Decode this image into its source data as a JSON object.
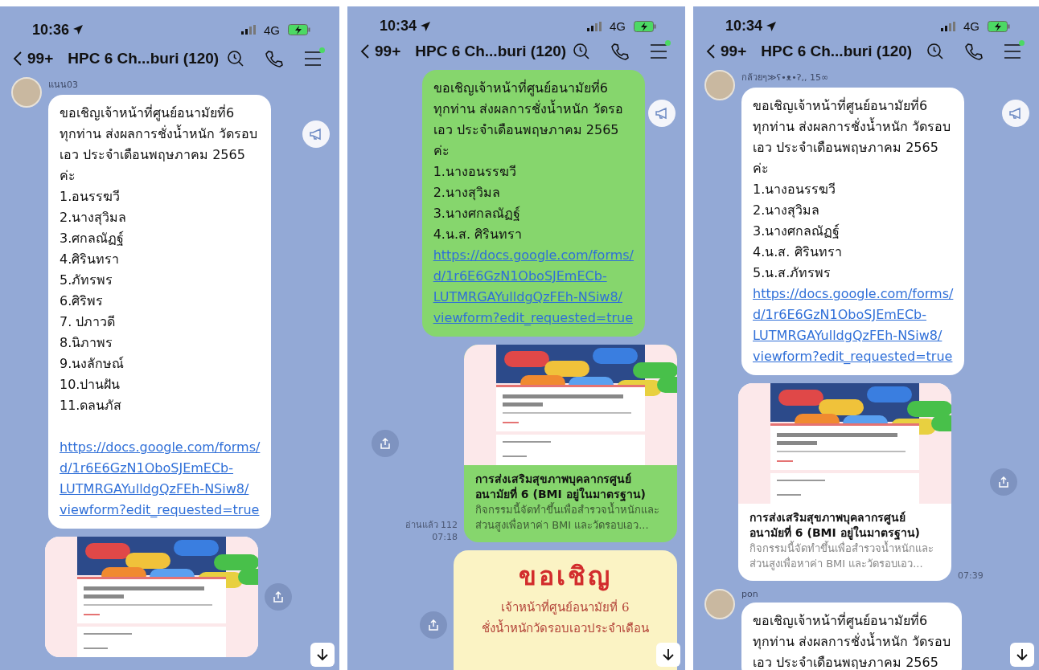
{
  "panels": [
    {
      "status_bar": {
        "time": "10:36",
        "network": "4G"
      },
      "header": {
        "unread": "99+",
        "title": "HPC 6 Ch...buri (120)"
      },
      "messages": [
        {
          "kind": "text",
          "own": false,
          "sender": "แนน03",
          "lines": [
            "ขอเชิญเจ้าหน้าที่ศูนย์อนามัยที่6",
            "ทุกท่าน ส่งผลการชั่งน้ำหนัก วัดรอบ",
            "เอว ประจำเดือนพฤษภาคม 2565",
            "ค่ะ",
            "1.อนรรฆวี",
            "2.นางสุวิมล",
            "3.ศกลณัฏฐ์",
            "4.ศิรินทรา",
            "5.ภัทรพร",
            "6.ศิริพร",
            "7. ปภาวดี",
            "8.นิภาพร",
            "9.นงลักษณ์",
            "10.ปานฝัน",
            "11.ดลนภัส"
          ],
          "link_gap": true,
          "link_lines": [
            "https://docs.google.com/forms/",
            "d/1r6E6GzN1OboSJEmECb-",
            "LUTMRGAYulldgQzFEh-NSiw8/",
            "viewform?edit_requested=true"
          ]
        },
        {
          "kind": "link_preview",
          "own": false,
          "share_button": true
        }
      ]
    },
    {
      "status_bar": {
        "time": "10:34",
        "network": "4G"
      },
      "header": {
        "unread": "99+",
        "title": "HPC 6 Ch...buri (120)"
      },
      "messages": [
        {
          "kind": "text",
          "own": true,
          "lines": [
            "ขอเชิญเจ้าหน้าที่ศูนย์อนามัยที่6",
            "ทุกท่าน ส่งผลการชั่งน้ำหนัก วัดรอ",
            "เอว ประจำเดือนพฤษภาคม 2565",
            "ค่ะ",
            "1.นางอนรรฆวี",
            "2.นางสุวิมล",
            "3.นางศกลณัฏฐ์",
            "4.น.ส. ศิรินทรา"
          ],
          "link_lines": [
            "https://docs.google.com/forms/",
            "d/1r6E6GzN1OboSJEmECb-",
            "LUTMRGAYulldgQzFEh-NSiw8/",
            "viewform?edit_requested=true"
          ]
        },
        {
          "kind": "link_preview",
          "own": true,
          "share_button": true,
          "title_lines": [
            "การส่งเสริมสุขภาพบุคลากรศูนย์",
            "อนามัยที่ 6 (BMI อยู่ในมาตรฐาน)"
          ],
          "description_lines": [
            "กิจกรรมนี้จัดทำขึ้นเพื่อสำรวจน้ำหนักและ",
            "ส่วนสูงเพื่อหาค่า BMI และวัดรอบเอว..."
          ],
          "read": "อ่านแล้ว 112",
          "time": "07:18"
        },
        {
          "kind": "poster",
          "own": true,
          "share_button": true,
          "title": "ขอเชิญ",
          "lines": [
            "เจ้าหน้าที่ศูนย์อนามัยที่ 6",
            "ชั่งน้ำหนักวัดรอบเอวประจำเดือน"
          ]
        }
      ]
    },
    {
      "status_bar": {
        "time": "10:34",
        "network": "4G"
      },
      "header": {
        "unread": "99+",
        "title": "HPC 6 Ch...buri (120)"
      },
      "messages": [
        {
          "kind": "text",
          "own": false,
          "sender": "กล้วยๆ≫ʕ•ᴥ•ʔ,, 15∞",
          "lines": [
            "ขอเชิญเจ้าหน้าที่ศูนย์อนามัยที่6",
            "ทุกท่าน ส่งผลการชั่งน้ำหนัก วัดรอบ",
            "เอว ประจำเดือนพฤษภาคม 2565",
            "ค่ะ",
            "1.นางอนรรฆวี",
            "2.นางสุวิมล",
            "3.นางศกลณัฏฐ์",
            "4.น.ส. ศิรินทรา",
            "5.น.ส.ภัทรพร"
          ],
          "link_lines": [
            "https://docs.google.com/forms/",
            "d/1r6E6GzN1OboSJEmECb-",
            "LUTMRGAYulldgQzFEh-NSiw8/",
            "viewform?edit_requested=true"
          ]
        },
        {
          "kind": "link_preview",
          "own": false,
          "share_button": true,
          "title_lines": [
            "การส่งเสริมสุขภาพบุคลากรศูนย์",
            "อนามัยที่ 6 (BMI อยู่ในมาตรฐาน)"
          ],
          "description_lines": [
            "กิจกรรมนี้จัดทำขึ้นเพื่อสำรวจน้ำหนักและ",
            "ส่วนสูงเพื่อหาค่า BMI และวัดรอบเอว..."
          ],
          "time": "07:39"
        },
        {
          "kind": "text",
          "own": false,
          "sender": "pon",
          "lines": [
            "ขอเชิญเจ้าหน้าที่ศูนย์อนามัยที่6",
            "ทุกท่าน ส่งผลการชั่งน้ำหนัก วัดรอบ",
            "เอว ประจำเดือนพฤษภาคม 2565"
          ]
        }
      ]
    }
  ]
}
